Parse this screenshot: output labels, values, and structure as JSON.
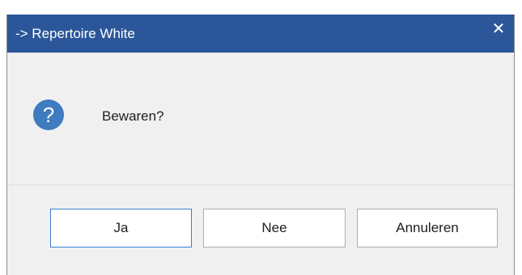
{
  "window": {
    "title": "-> Repertoire White",
    "close_label": "✕"
  },
  "message": {
    "text": "Bewaren?",
    "icon": "question-icon"
  },
  "buttons": {
    "yes_label": "Ja",
    "no_label": "Nee",
    "cancel_label": "Annuleren"
  },
  "colors": {
    "titlebar": "#2b579a",
    "question_icon": "#3e7bbf",
    "default_button_border": "#3b7fd1"
  }
}
